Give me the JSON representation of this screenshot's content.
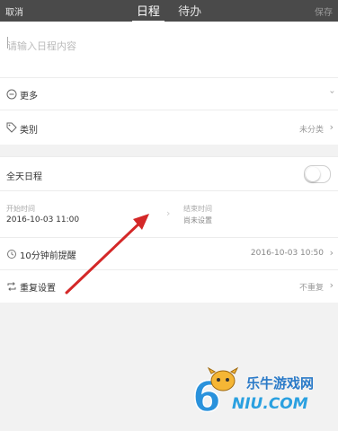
{
  "header": {
    "cancel": "取消",
    "save": "保存",
    "tabs": [
      {
        "label": "日程",
        "active": true
      },
      {
        "label": "待办",
        "active": false
      }
    ]
  },
  "input": {
    "placeholder": "请输入日程内容",
    "value": ""
  },
  "more": {
    "label": "更多"
  },
  "category": {
    "label": "类别",
    "value": "未分类"
  },
  "all_day": {
    "label": "全天日程",
    "enabled": false
  },
  "time": {
    "start_label": "开始时间",
    "start_value": "2016-10-03 11:00",
    "end_label": "结束时间",
    "end_value": "尚未设置"
  },
  "reminder": {
    "label": "10分钟前提醒",
    "value": "2016-10-03 10:50"
  },
  "repeat": {
    "label": "重复设置",
    "value": "不重复"
  },
  "watermark": {
    "brand": "乐牛游戏网",
    "url": "NIU.COM",
    "logo_digit": "6"
  },
  "colors": {
    "header_bg": "#4a4a4a",
    "arrow": "#d42828",
    "watermark_blue": "#2a7ac8"
  }
}
